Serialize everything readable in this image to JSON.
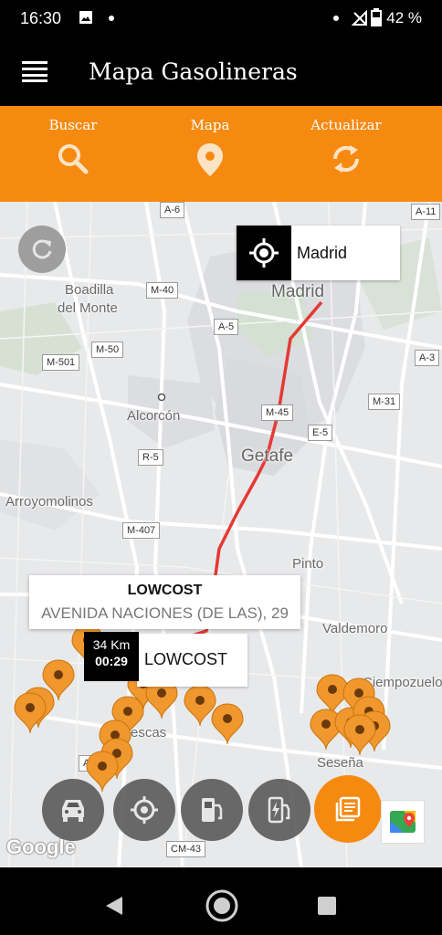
{
  "status_bar": {
    "time": "16:30",
    "battery": "42 %",
    "icons": [
      "image-icon",
      "dot-icon",
      "dot-icon",
      "signal-icon",
      "battery-icon"
    ]
  },
  "app_bar": {
    "menu_icon": "hamburger-menu-icon",
    "title": "Mapa Gasolineras"
  },
  "toolbar": {
    "buscar": "Buscar",
    "mapa": "Mapa",
    "actualizar": "Actualizar"
  },
  "map": {
    "location_card": {
      "name": "Madrid"
    },
    "places": [
      {
        "id": "boadilla-1",
        "text": "Boadilla"
      },
      {
        "id": "boadilla-2",
        "text": "del Monte"
      },
      {
        "id": "madrid",
        "text": "Madrid"
      },
      {
        "id": "alcorcon",
        "text": "Alcorcón"
      },
      {
        "id": "getafe",
        "text": "Getafe"
      },
      {
        "id": "arroyomolinos",
        "text": "Arroyomolinos"
      },
      {
        "id": "pinto",
        "text": "Pinto"
      },
      {
        "id": "valdemoro",
        "text": "Valdemoro"
      },
      {
        "id": "ciempozuelos",
        "text": "Ciempozuelos"
      },
      {
        "id": "sesena",
        "text": "Seseña"
      },
      {
        "id": "illescas",
        "text": "escas"
      }
    ],
    "roads": [
      "A-6",
      "A-11",
      "M-40",
      "M-50",
      "A-5",
      "M-501",
      "A-3",
      "M-31",
      "M-45",
      "E-5",
      "R-5",
      "M-407",
      "AP",
      "CM-43"
    ],
    "info_window": {
      "title": "LOWCOST",
      "address": "AVENIDA NACIONES (DE LAS), 29"
    },
    "lowcost_label": "LOWCOST",
    "eta": {
      "distance": "34 Km",
      "duration": "00:29"
    },
    "attribution": "Google"
  },
  "fab_actions": [
    "car-icon",
    "target-icon",
    "fuel-pump-icon",
    "ev-charger-icon",
    "list-icon"
  ],
  "colors": {
    "accent": "#f68a11",
    "route": "#e53935",
    "marker": "#f0982e"
  }
}
